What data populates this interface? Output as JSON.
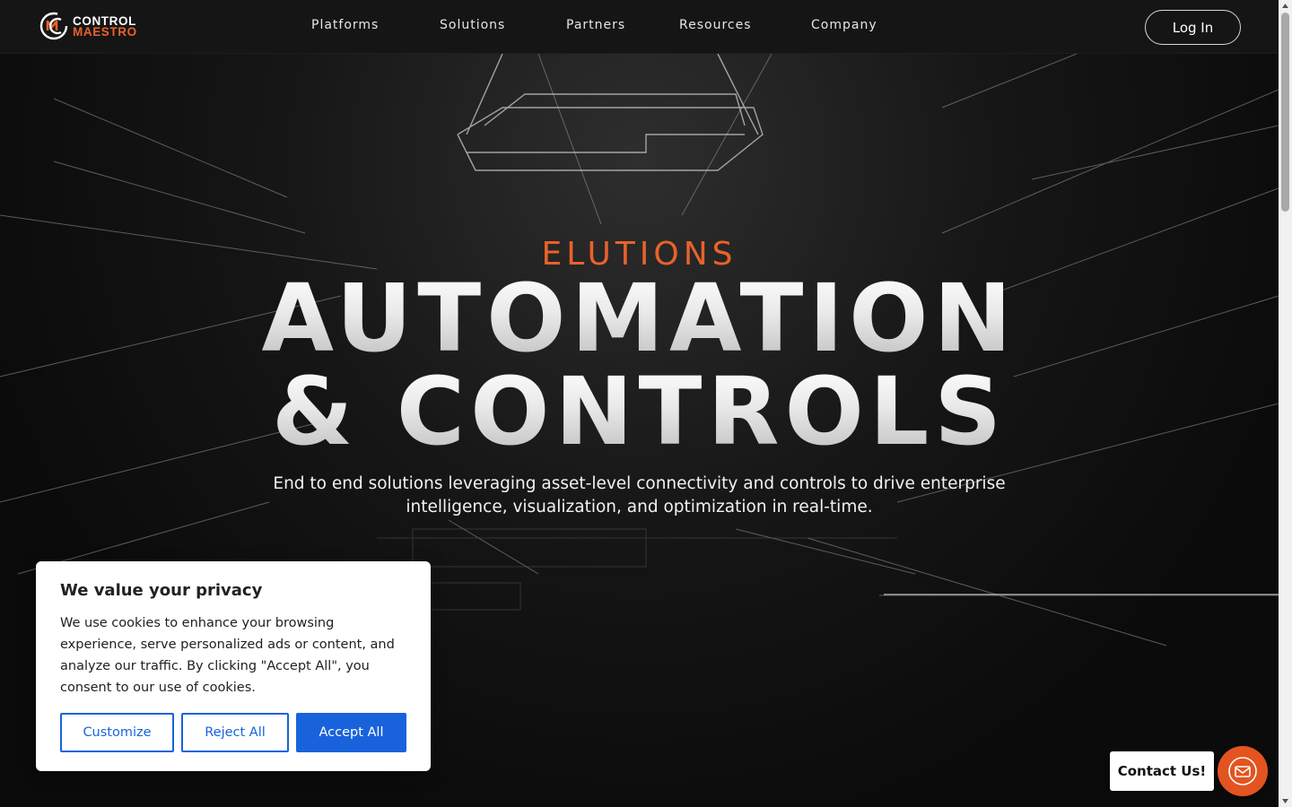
{
  "brand": {
    "line1": "CONTROL",
    "line2": "MAESTRO",
    "accent_color": "#e8622a"
  },
  "nav": {
    "items": [
      {
        "label": "Platforms"
      },
      {
        "label": "Solutions"
      },
      {
        "label": "Partners"
      },
      {
        "label": "Resources"
      },
      {
        "label": "Company"
      }
    ],
    "login_label": "Log In"
  },
  "hero": {
    "eyebrow": "ELUTIONS",
    "headline_line1": "AUTOMATION",
    "headline_line2": "& CONTROLS",
    "subtitle": "End to end solutions leveraging asset-level connectivity and controls to drive enterprise intelligence, visualization, and optimization in real-time."
  },
  "cookie_banner": {
    "title": "We value your privacy",
    "text": "We use cookies to enhance your browsing experience, serve personalized ads or content, and analyze our traffic. By clicking \"Accept All\", you consent to our use of cookies.",
    "customize_label": "Customize",
    "reject_label": "Reject All",
    "accept_label": "Accept All",
    "button_color": "#1863dc"
  },
  "contact": {
    "label": "Contact Us!",
    "icon": "mail-icon",
    "fab_color": "#e35420"
  }
}
